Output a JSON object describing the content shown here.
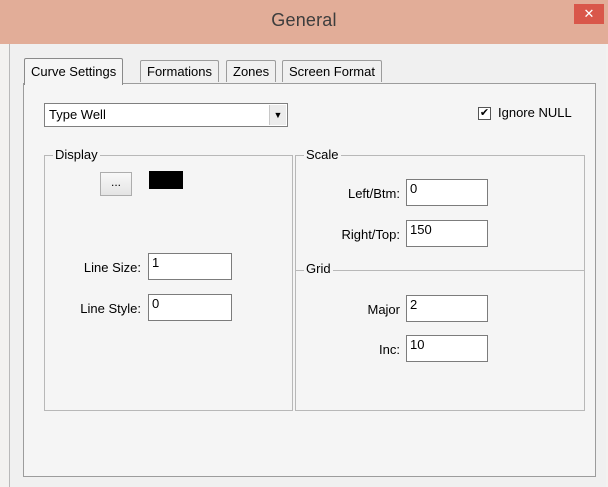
{
  "window": {
    "title": "General",
    "close_glyph": "✕"
  },
  "tabs": [
    {
      "label": "Curve Settings",
      "active": true
    },
    {
      "label": "Formations",
      "active": false
    },
    {
      "label": "Zones",
      "active": false
    },
    {
      "label": "Screen Format",
      "active": false
    }
  ],
  "curve_select": {
    "value": "Type Well",
    "arrow_glyph": "▼"
  },
  "ignore_null": {
    "label": "Ignore NULL",
    "checked": true,
    "check_glyph": "✔"
  },
  "display": {
    "title": "Display",
    "color_button_label": "...",
    "line_size_label": "Line Size:",
    "line_size_value": "1",
    "line_style_label": "Line Style:",
    "line_style_value": "0"
  },
  "scale": {
    "title": "Scale",
    "left_label": "Left/Btm:",
    "left_value": "0",
    "right_label": "Right/Top:",
    "right_value": "150"
  },
  "grid": {
    "title": "Grid",
    "major_label": "Major",
    "major_value": "2",
    "inc_label": "Inc:",
    "inc_value": "10"
  },
  "colors": {
    "title_bar": "#e2ad98",
    "close_button": "#d9574a",
    "line_color": "#000000"
  }
}
